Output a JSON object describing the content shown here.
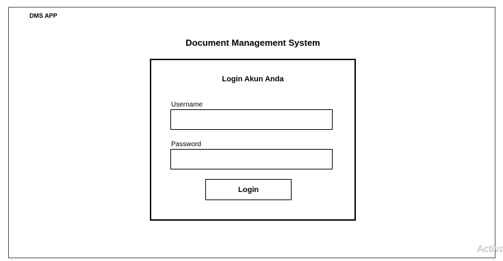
{
  "app": {
    "name": "DMS APP"
  },
  "page": {
    "title": "Document Management System"
  },
  "login_form": {
    "title": "Login Akun Anda",
    "username_label": "Username",
    "username_value": "",
    "password_label": "Password",
    "password_value": "",
    "submit_label": "Login"
  },
  "watermark": {
    "text": "Activa"
  }
}
